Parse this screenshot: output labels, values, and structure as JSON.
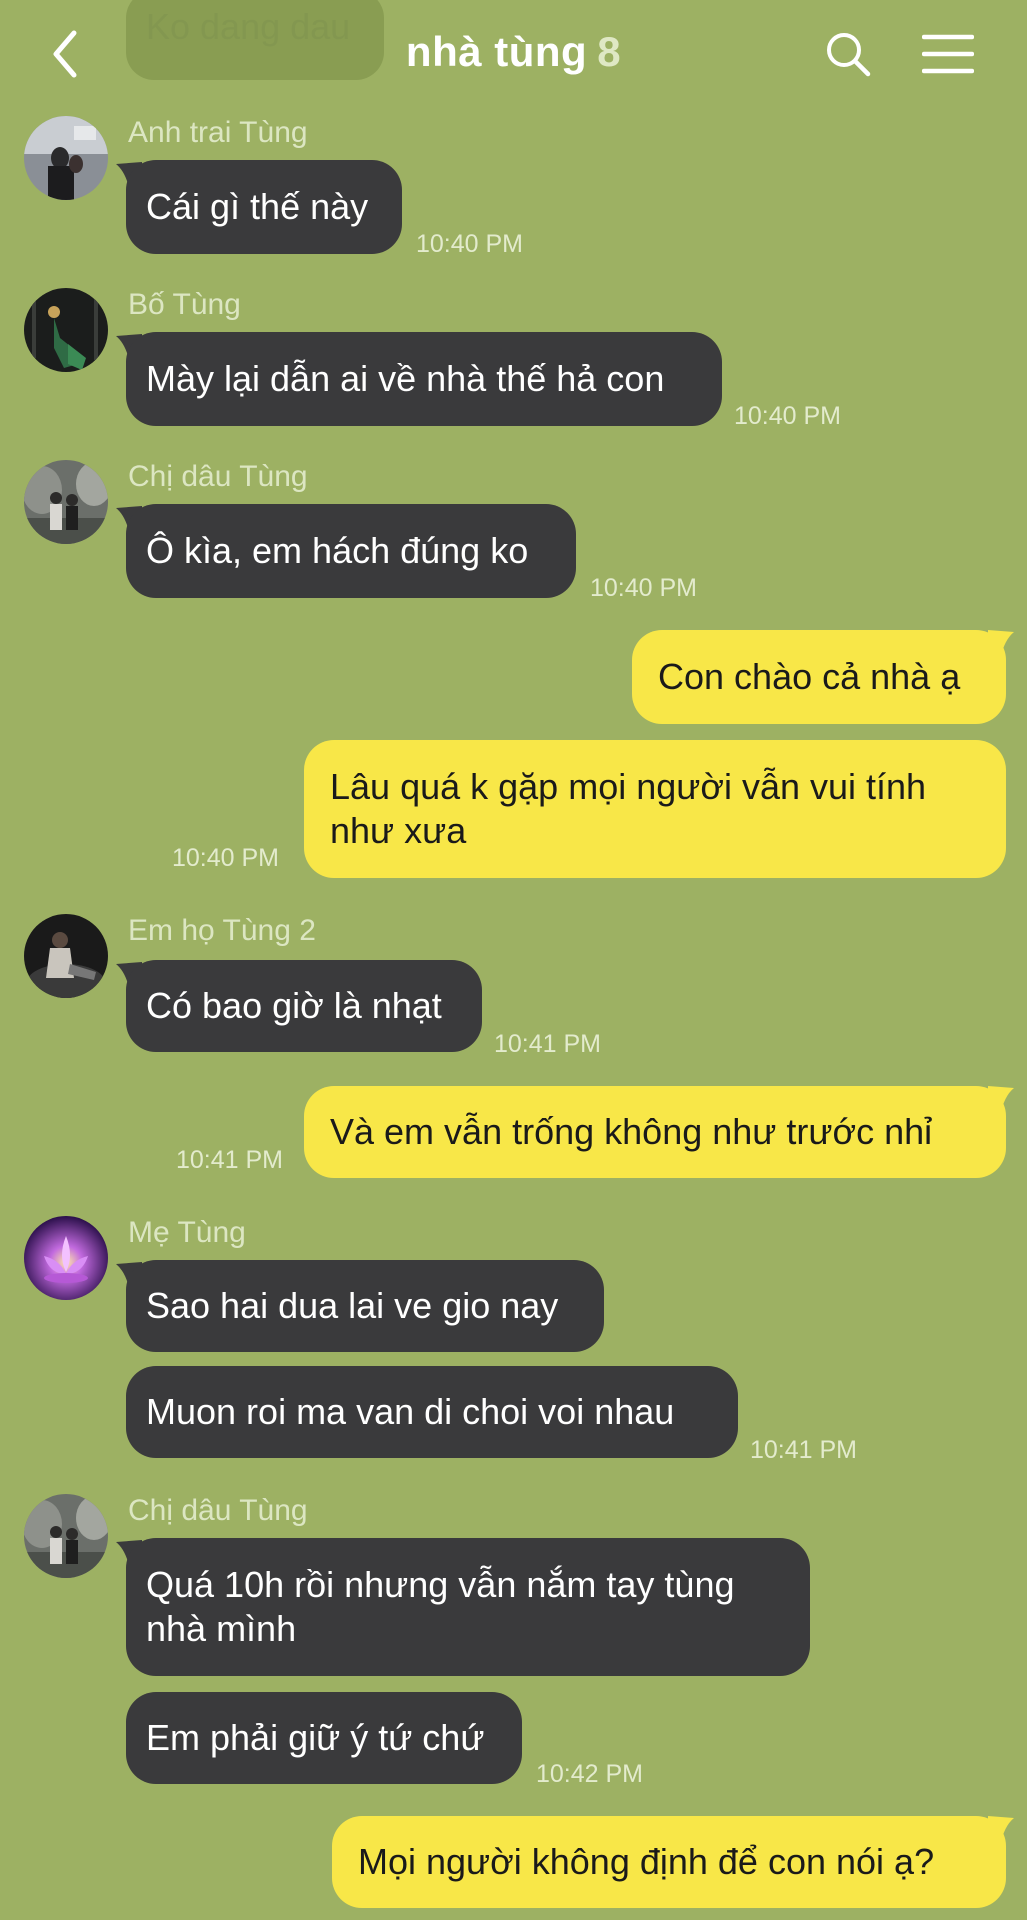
{
  "header": {
    "title": "nhà tùng",
    "member_count": "8",
    "back_icon": "chevron-left-icon",
    "search_icon": "search-icon",
    "menu_icon": "hamburger-menu-icon"
  },
  "ghost_message": "Ko dang dau",
  "colors": {
    "background": "#9db163",
    "incoming_bubble": "#3a3a3c",
    "outgoing_bubble": "#f8e748",
    "sender_name": "#dce6c2",
    "time": "#e3ebcd"
  },
  "messages": [
    {
      "sender": "Anh trai Tùng",
      "text": "Cái gì thế này",
      "time": "10:40 PM"
    },
    {
      "sender": "Bố Tùng",
      "text": "Mày lại dẫn ai về nhà thế hả con",
      "time": "10:40 PM"
    },
    {
      "sender": "Chị dâu Tùng",
      "text": "Ô kìa, em hách đúng ko",
      "time": "10:40 PM"
    },
    {
      "text": "Con chào cả nhà ạ"
    },
    {
      "text": "Lâu quá k gặp mọi người vẫn vui tính như xưa",
      "time": "10:40 PM"
    },
    {
      "sender": "Em họ Tùng 2",
      "text": "Có bao giờ là nhạt",
      "time": "10:41 PM"
    },
    {
      "text": "Và em vẫn trống không như trước nhỉ",
      "time": "10:41 PM"
    },
    {
      "sender": "Mẹ Tùng",
      "text": "Sao hai dua lai ve gio nay"
    },
    {
      "text": "Muon roi ma van di choi voi nhau",
      "time": "10:41 PM"
    },
    {
      "sender": "Chị dâu Tùng",
      "text": "Quá 10h rồi nhưng vẫn nắm tay tùng nhà mình"
    },
    {
      "text": "Em phải giữ ý tứ chứ",
      "time": "10:42 PM"
    },
    {
      "text": "Mọi người không định để con nói ạ?"
    }
  ]
}
